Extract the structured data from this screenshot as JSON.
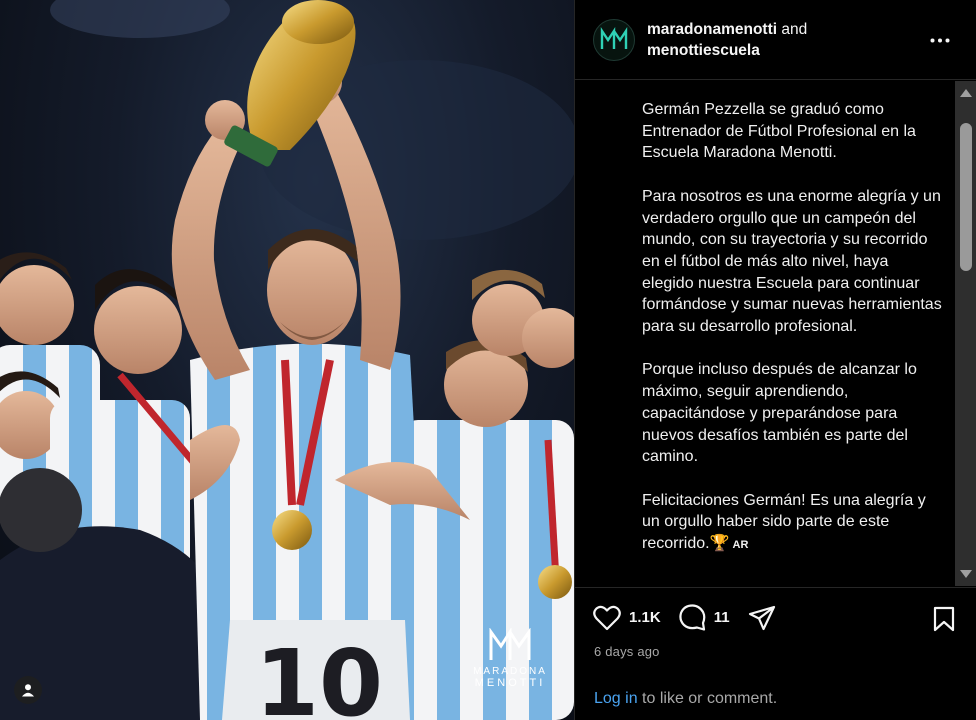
{
  "post": {
    "authors": {
      "primary": "maradonamenotti",
      "joiner": "and",
      "secondary": "menottiescuela"
    },
    "caption": {
      "p1": "Germán Pezzella se graduó como Entrenador de Fútbol Profesional en la Escuela Maradona Menotti.",
      "p2": "Para nosotros es una enorme alegría y un verdadero orgullo que un campeón del mundo, con su trayectoria y su recorrido en el fútbol de más alto nivel, haya elegido nuestra Escuela para continuar formándose y sumar nuevas herramientas para su desarrollo profesional.",
      "p3": "Porque incluso después de alcanzar lo máximo, seguir aprendiendo, capacitándose y preparándose para nuevos desafíos también es parte del camino.",
      "p4": "Felicitaciones Germán! Es una alegría y un orgullo haber sido parte de este recorrido.",
      "p4_emoji": "🏆",
      "p4_flag": "AR"
    },
    "likes": "1.1K",
    "comments": "11",
    "time_ago": "6 days ago",
    "login_prompt": {
      "link": "Log in",
      "rest": " to like or comment."
    },
    "photo_logo": {
      "line1": "MARADONA",
      "line2": "MENOTTI"
    }
  },
  "icons": {
    "more": "more-horizontal-icon",
    "like": "heart-icon",
    "comment": "comment-bubble-icon",
    "share": "paper-plane-icon",
    "save": "bookmark-icon",
    "tag": "user-tag-icon"
  },
  "colors": {
    "background": "#000000",
    "border": "#262626",
    "link": "#4aa3f0",
    "muted": "#a8a8a8",
    "avatar_accent": "#2fd1b5"
  }
}
